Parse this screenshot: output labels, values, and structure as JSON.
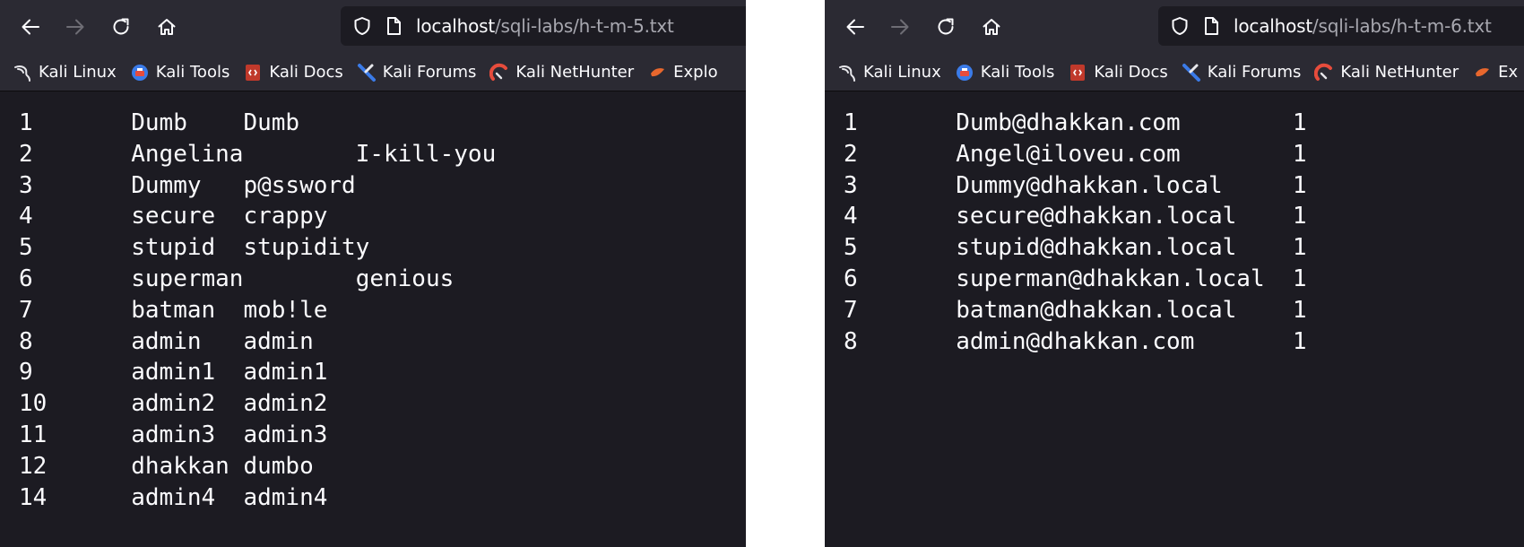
{
  "left": {
    "url": {
      "host": "localhost",
      "path": "/sqli-labs/h-t-m-5.txt"
    },
    "bookmarks": [
      {
        "label": "Kali Linux",
        "icon": "kali-dragon-icon"
      },
      {
        "label": "Kali Tools",
        "icon": "kali-tools-icon"
      },
      {
        "label": "Kali Docs",
        "icon": "kali-docs-icon"
      },
      {
        "label": "Kali Forums",
        "icon": "kali-forums-icon"
      },
      {
        "label": "Kali NetHunter",
        "icon": "kali-nethunter-icon"
      },
      {
        "label": "Explo",
        "icon": "exploit-db-icon"
      }
    ],
    "content": "1\tDumb\tDumb\n2\tAngelina\tI-kill-you\n3\tDummy\tp@ssword\n4\tsecure\tcrappy\n5\tstupid\tstupidity\n6\tsuperman\tgenious\n7\tbatman\tmob!le\n8\tadmin\tadmin\n9\tadmin1\tadmin1\n10\tadmin2\tadmin2\n11\tadmin3\tadmin3\n12\tdhakkan\tdumbo\n14\tadmin4\tadmin4"
  },
  "right": {
    "url": {
      "host": "localhost",
      "path": "/sqli-labs/h-t-m-6.txt"
    },
    "bookmarks": [
      {
        "label": "Kali Linux",
        "icon": "kali-dragon-icon"
      },
      {
        "label": "Kali Tools",
        "icon": "kali-tools-icon"
      },
      {
        "label": "Kali Docs",
        "icon": "kali-docs-icon"
      },
      {
        "label": "Kali Forums",
        "icon": "kali-forums-icon"
      },
      {
        "label": "Kali NetHunter",
        "icon": "kali-nethunter-icon"
      },
      {
        "label": "Ex",
        "icon": "exploit-db-icon"
      }
    ],
    "content": "1\tDumb@dhakkan.com\t1\n2\tAngel@iloveu.com\t1\n3\tDummy@dhakkan.local\t1\n4\tsecure@dhakkan.local\t1\n5\tstupid@dhakkan.local\t1\n6\tsuperman@dhakkan.local\t1\n7\tbatman@dhakkan.local\t1\n8\tadmin@dhakkan.com\t1"
  },
  "colors": {
    "toolbar": "#2b2a33",
    "page_background": "#1c1b22",
    "text": "#fbfbfe",
    "url_path": "#a8a8b0",
    "separator": "#ffffff"
  }
}
